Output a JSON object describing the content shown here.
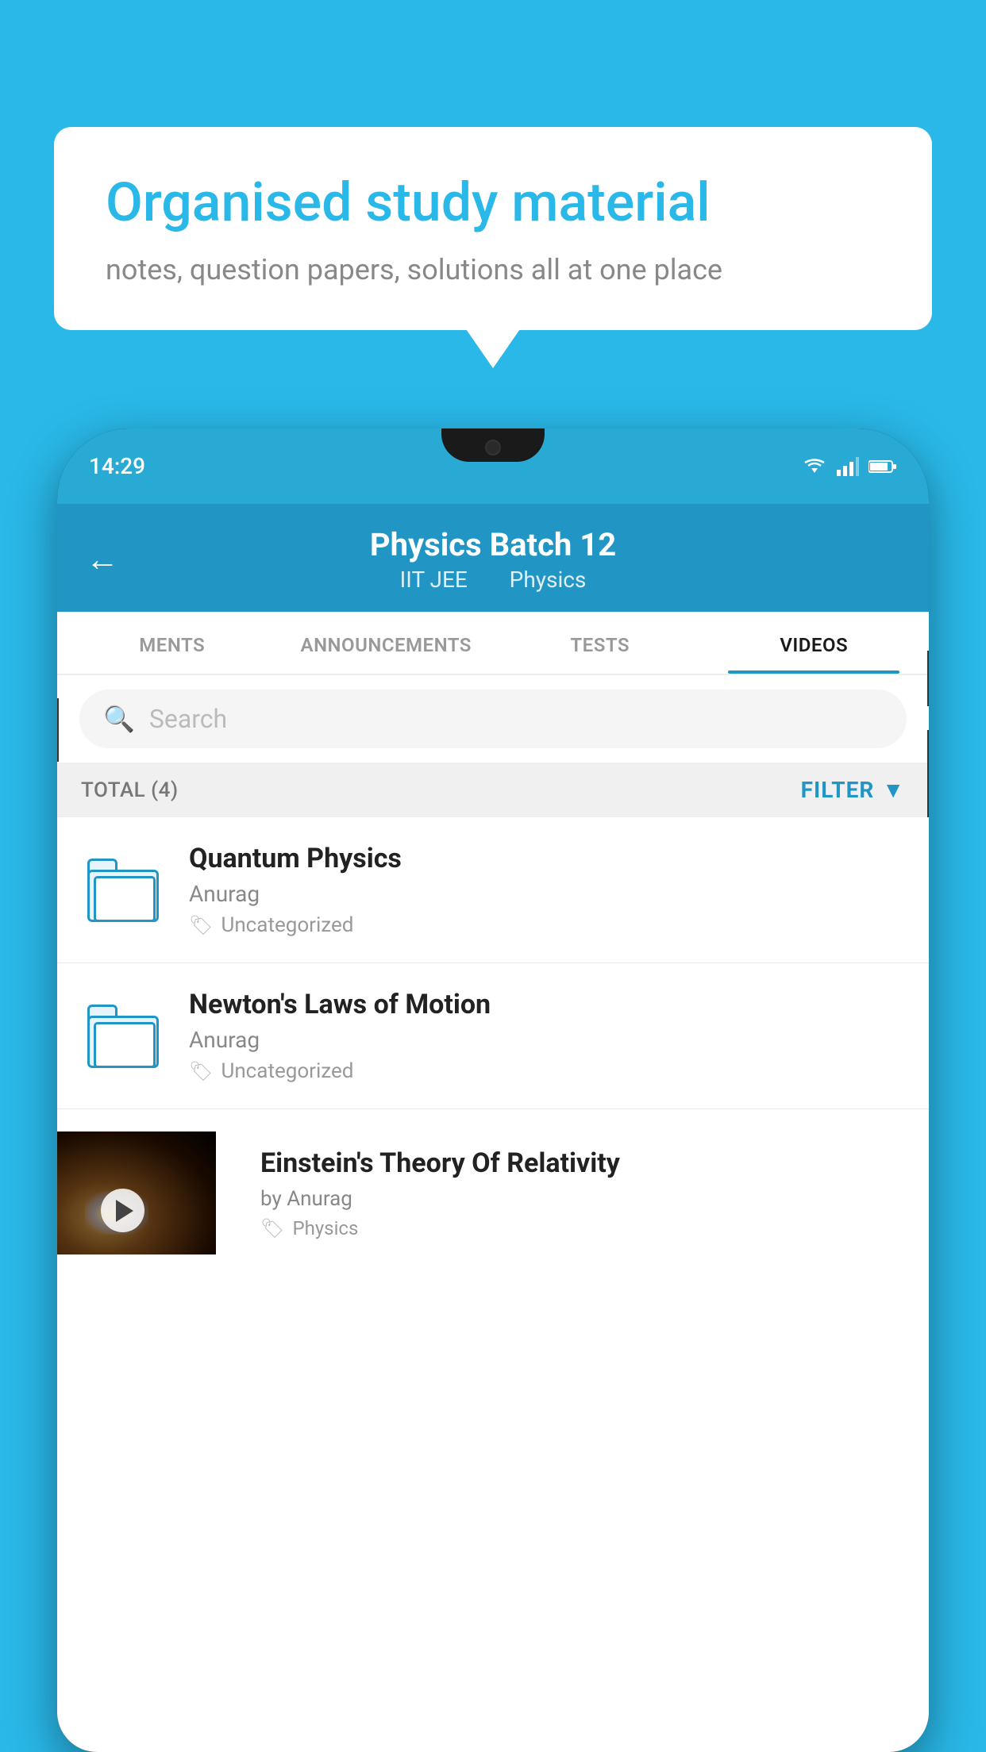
{
  "background_color": "#29b8e8",
  "bubble": {
    "title": "Organised study material",
    "subtitle": "notes, question papers, solutions all at one place"
  },
  "phone": {
    "status_time": "14:29",
    "header": {
      "title": "Physics Batch 12",
      "subtitle1": "IIT JEE",
      "subtitle2": "Physics"
    },
    "tabs": [
      {
        "label": "MENTS",
        "active": false
      },
      {
        "label": "ANNOUNCEMENTS",
        "active": false
      },
      {
        "label": "TESTS",
        "active": false
      },
      {
        "label": "VIDEOS",
        "active": true
      }
    ],
    "search": {
      "placeholder": "Search"
    },
    "filter": {
      "total_label": "TOTAL (4)",
      "filter_label": "FILTER"
    },
    "videos": [
      {
        "title": "Quantum Physics",
        "author": "Anurag",
        "tag": "Uncategorized",
        "type": "folder"
      },
      {
        "title": "Newton's Laws of Motion",
        "author": "Anurag",
        "tag": "Uncategorized",
        "type": "folder"
      },
      {
        "title": "Einstein's Theory Of Relativity",
        "author": "by Anurag",
        "tag": "Physics",
        "type": "video"
      }
    ]
  }
}
